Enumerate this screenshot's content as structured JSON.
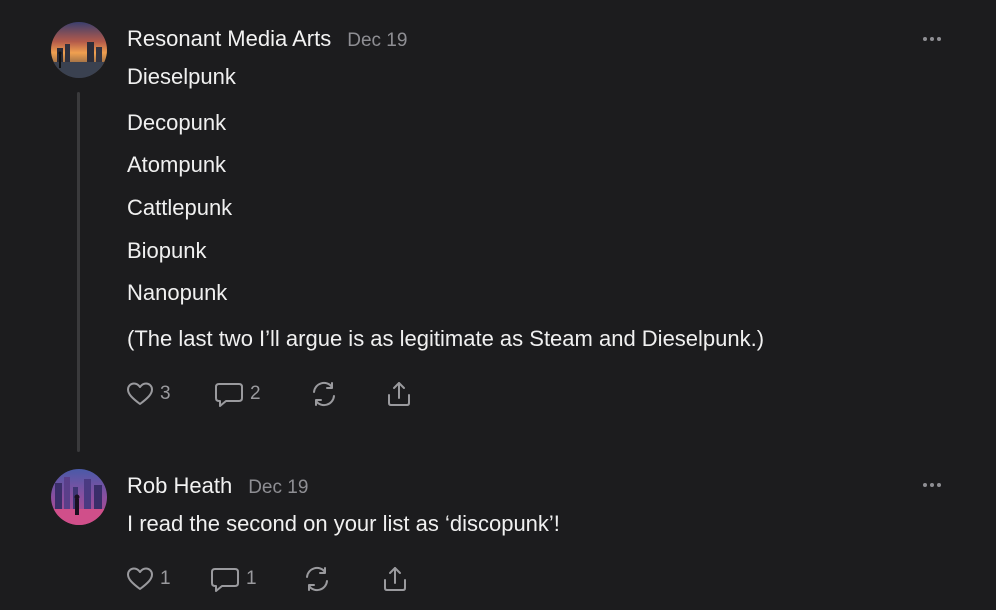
{
  "comments": [
    {
      "author": "Resonant Media Arts",
      "date": "Dec 19",
      "lines": [
        "Dieselpunk",
        "Decopunk",
        "Atompunk",
        "Cattlepunk",
        "Biopunk",
        "Nanopunk",
        "(The last two I’ll argue is as legitimate as Steam and Dieselpunk.)"
      ],
      "like_count": "3",
      "reply_count": "2",
      "icons": [
        "heart-icon",
        "comment-icon",
        "restack-icon",
        "share-icon",
        "more-icon"
      ]
    },
    {
      "author": "Rob Heath",
      "date": "Dec 19",
      "lines": [
        "I read the second on your list as ‘discopunk’!"
      ],
      "like_count": "1",
      "reply_count": "1",
      "icons": [
        "heart-icon",
        "comment-icon",
        "restack-icon",
        "share-icon",
        "more-icon"
      ]
    }
  ],
  "colors": {
    "background": "#1c1c1e",
    "text": "#f0f0f0",
    "muted": "#8e8e93",
    "thread_line": "#3a3a3c"
  }
}
